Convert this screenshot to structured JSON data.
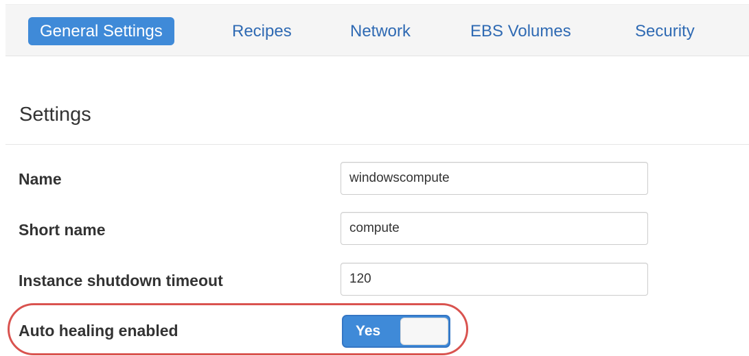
{
  "tabs": [
    {
      "label": "General Settings",
      "active": true
    },
    {
      "label": "Recipes",
      "active": false
    },
    {
      "label": "Network",
      "active": false
    },
    {
      "label": "EBS Volumes",
      "active": false
    },
    {
      "label": "Security",
      "active": false
    }
  ],
  "section": {
    "title": "Settings"
  },
  "fields": {
    "name": {
      "label": "Name",
      "value": "windowscompute"
    },
    "short_name": {
      "label": "Short name",
      "value": "compute"
    },
    "shutdown_timeout": {
      "label": "Instance shutdown timeout",
      "value": "120"
    },
    "auto_healing": {
      "label": "Auto healing enabled",
      "toggle_text": "Yes",
      "enabled": true
    }
  },
  "colors": {
    "accent": "#3f8ad8",
    "link": "#2f6ab3",
    "highlight": "#d9534f"
  }
}
